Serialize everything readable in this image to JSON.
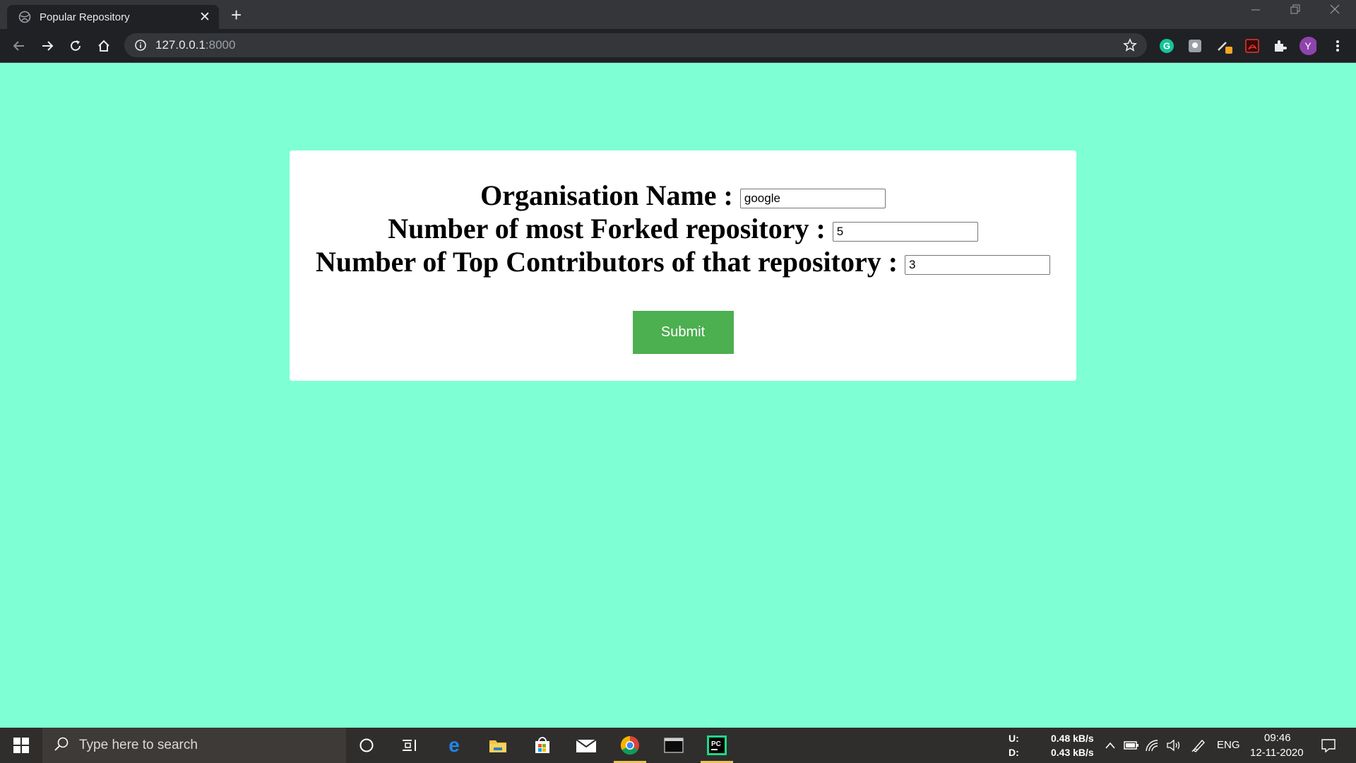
{
  "browser": {
    "tab_title": "Popular Repository",
    "tab_close": "✕",
    "new_tab": "+",
    "url_host": "127.0.0.1",
    "url_port": ":8000",
    "profile_initial": "Y"
  },
  "form": {
    "org_label": "Organisation Name :",
    "org_value": "google",
    "forked_label": "Number of most Forked repository :",
    "forked_value": "5",
    "contributors_label": "Number of Top Contributors of that repository :",
    "contributors_value": "3",
    "submit_label": "Submit"
  },
  "taskbar": {
    "search_placeholder": "Type here to search",
    "upload_label": "U:",
    "download_label": "D:",
    "upload_speed": "0.48 kB/s",
    "download_speed": "0.43 kB/s",
    "language": "ENG",
    "time": "09:46",
    "date": "12-11-2020"
  },
  "colors": {
    "page_bg": "#7fffd4",
    "submit_bg": "#4caf50",
    "profile_bg": "#8e44ad"
  }
}
